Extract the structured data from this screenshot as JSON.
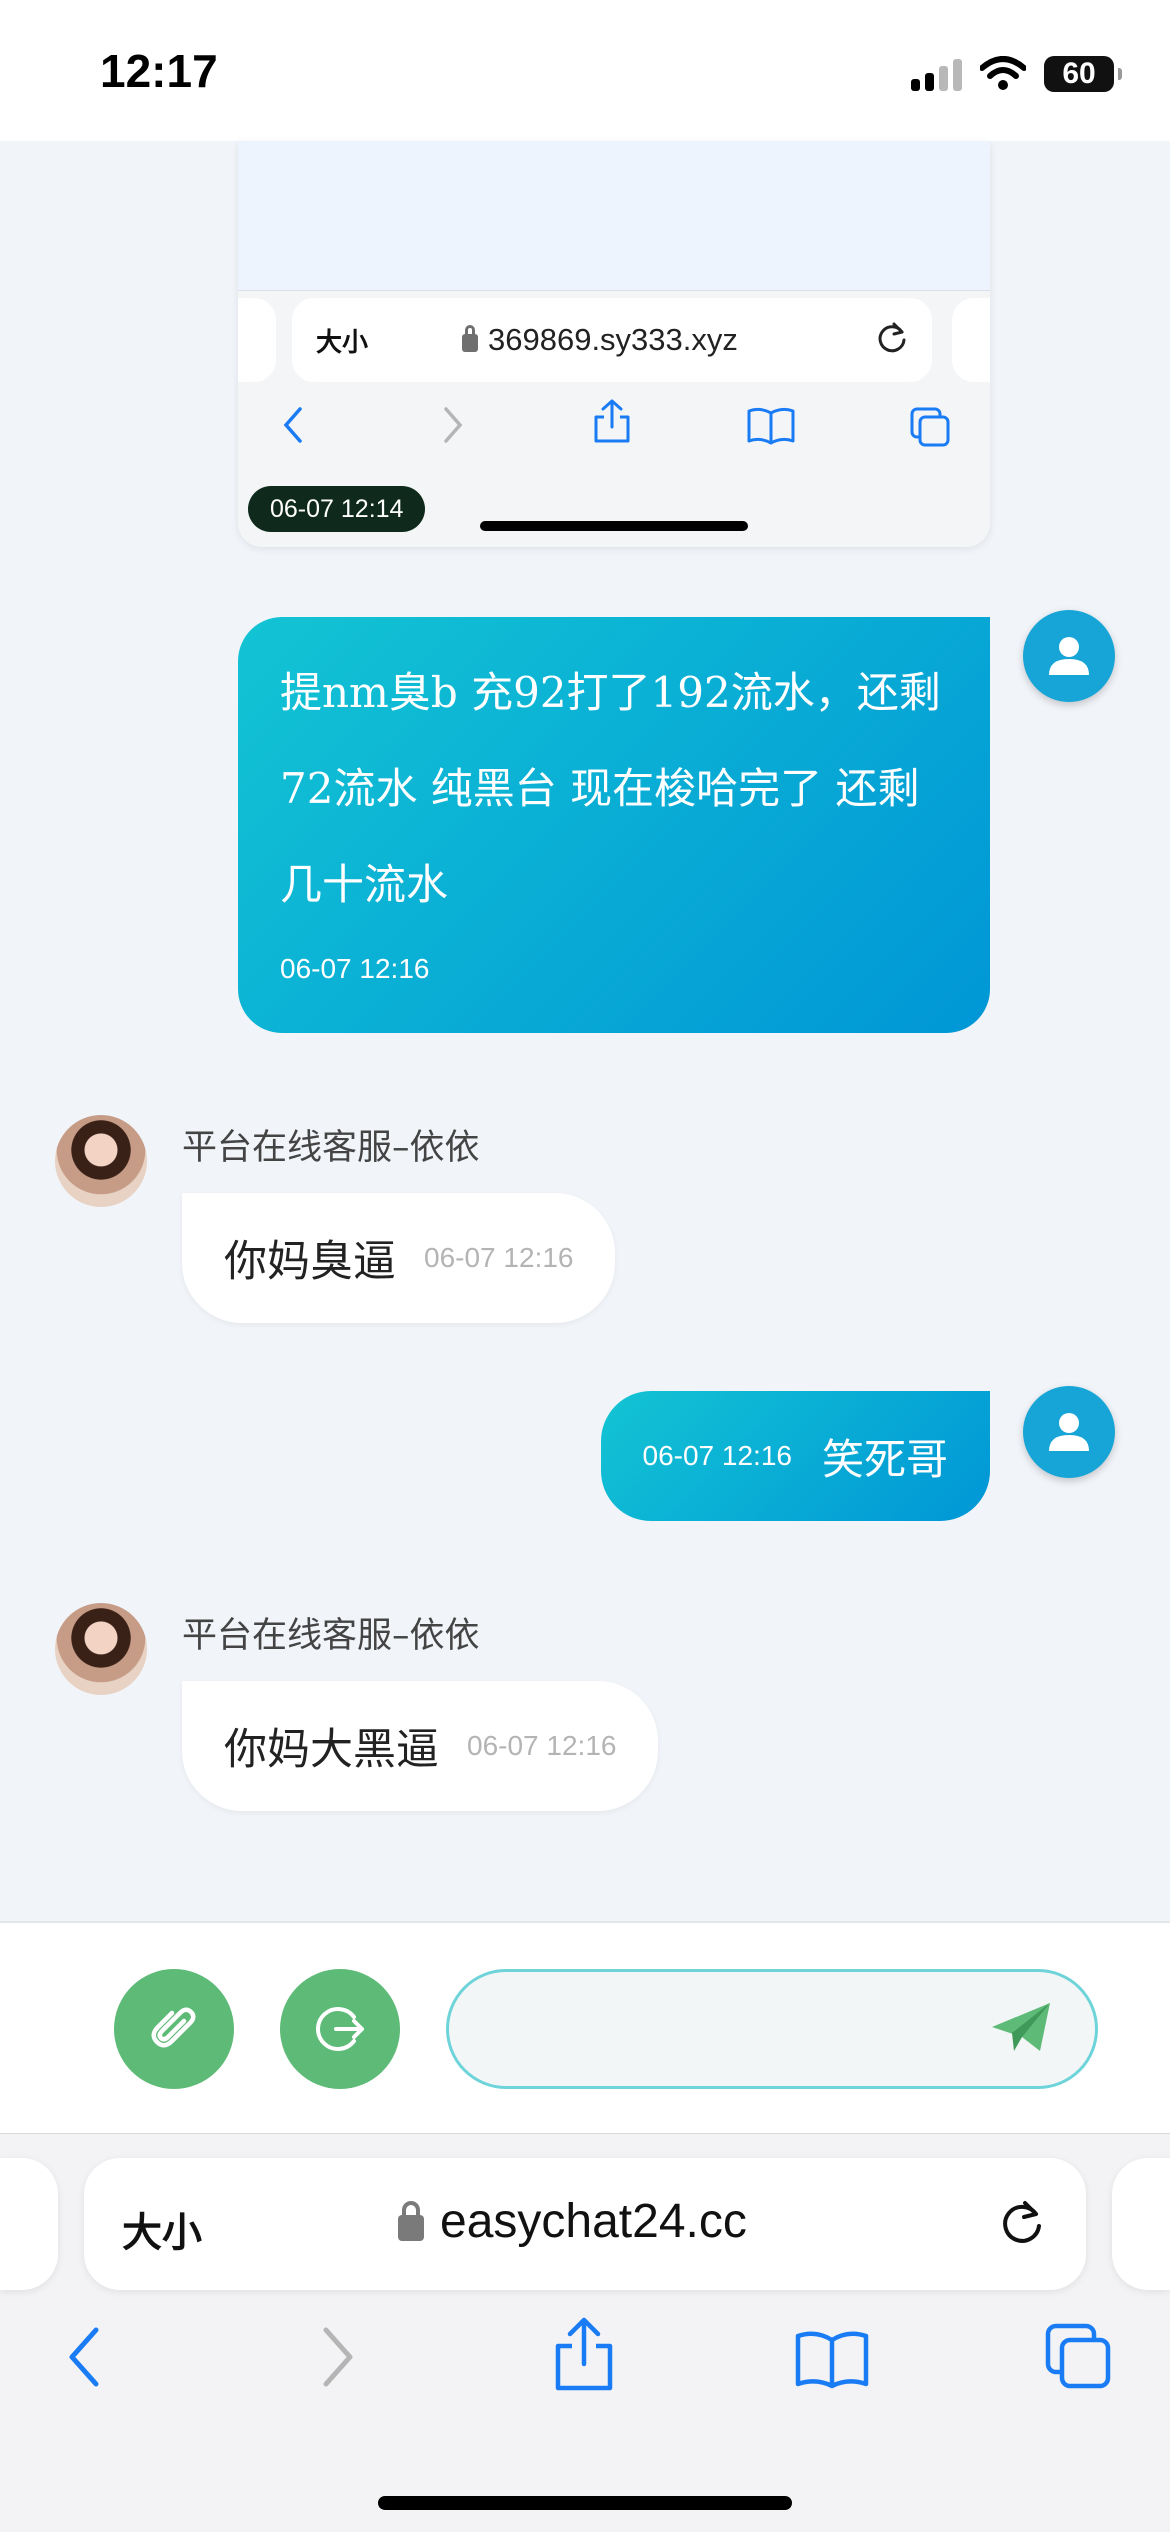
{
  "status": {
    "time": "12:17",
    "battery": "60"
  },
  "screenshot_msg": {
    "aa_label": "大小",
    "domain": "369869.sy333.xyz",
    "time": "06-07 12:14"
  },
  "messages": {
    "user_1": {
      "text": "提nm臭b 充92打了192流水，还剩72流水 纯黑台 现在梭哈完了 还剩几十流水",
      "time": "06-07 12:16"
    },
    "agent_1": {
      "name": "平台在线客服–依依",
      "text": "你妈臭逼",
      "time": "06-07 12:16"
    },
    "user_2": {
      "text": "笑死哥",
      "time": "06-07 12:16"
    },
    "agent_2": {
      "name": "平台在线客服–依依",
      "text": "你妈大黑逼",
      "time": "06-07 12:16"
    }
  },
  "composer": {
    "placeholder": ""
  },
  "browser": {
    "aa_label": "大小",
    "domain": "easychat24.cc"
  },
  "colors": {
    "accent_green": "#5dba77",
    "user_bubble": "#0aa9d8",
    "safari_blue": "#1a7cf5"
  },
  "icons": [
    "attachment-icon",
    "logout-icon",
    "send-icon",
    "user-icon",
    "lock-icon",
    "reload-icon",
    "back-icon",
    "forward-icon",
    "share-icon",
    "bookmarks-icon",
    "tabs-icon"
  ]
}
